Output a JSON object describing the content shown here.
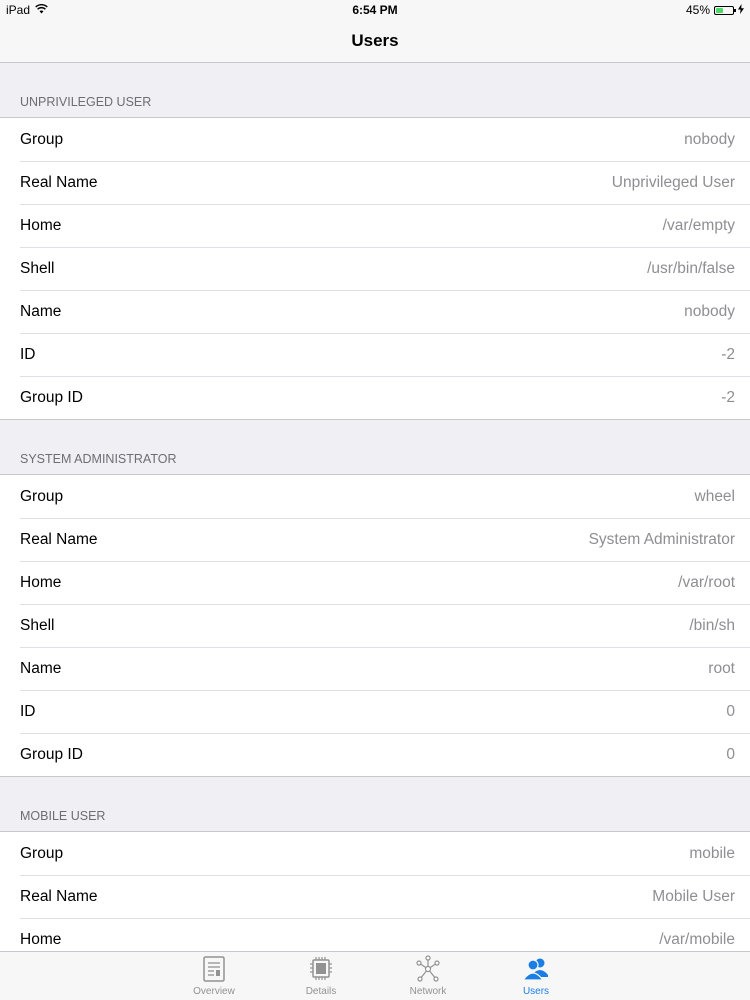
{
  "status_bar": {
    "device": "iPad",
    "time": "6:54 PM",
    "battery": "45%",
    "battery_level": 0.45
  },
  "nav": {
    "title": "Users"
  },
  "sections": [
    {
      "header": "UNPRIVILEGED USER",
      "rows": [
        {
          "label": "Group",
          "value": "nobody"
        },
        {
          "label": "Real Name",
          "value": "Unprivileged User"
        },
        {
          "label": "Home",
          "value": "/var/empty"
        },
        {
          "label": "Shell",
          "value": "/usr/bin/false"
        },
        {
          "label": "Name",
          "value": "nobody"
        },
        {
          "label": "ID",
          "value": "-2"
        },
        {
          "label": "Group ID",
          "value": "-2"
        }
      ]
    },
    {
      "header": "SYSTEM ADMINISTRATOR",
      "rows": [
        {
          "label": "Group",
          "value": "wheel"
        },
        {
          "label": "Real Name",
          "value": "System Administrator"
        },
        {
          "label": "Home",
          "value": "/var/root"
        },
        {
          "label": "Shell",
          "value": "/bin/sh"
        },
        {
          "label": "Name",
          "value": "root"
        },
        {
          "label": "ID",
          "value": "0"
        },
        {
          "label": "Group ID",
          "value": "0"
        }
      ]
    },
    {
      "header": "MOBILE USER",
      "rows": [
        {
          "label": "Group",
          "value": "mobile"
        },
        {
          "label": "Real Name",
          "value": "Mobile User"
        },
        {
          "label": "Home",
          "value": "/var/mobile"
        }
      ]
    }
  ],
  "tabs": [
    {
      "label": "Overview",
      "icon": "overview-icon",
      "active": false
    },
    {
      "label": "Details",
      "icon": "chip-icon",
      "active": false
    },
    {
      "label": "Network",
      "icon": "network-icon",
      "active": false
    },
    {
      "label": "Users",
      "icon": "users-icon",
      "active": true
    }
  ],
  "colors": {
    "accent": "#1a7ee5",
    "inactive_tab": "#929292",
    "battery": "#4cd964"
  }
}
